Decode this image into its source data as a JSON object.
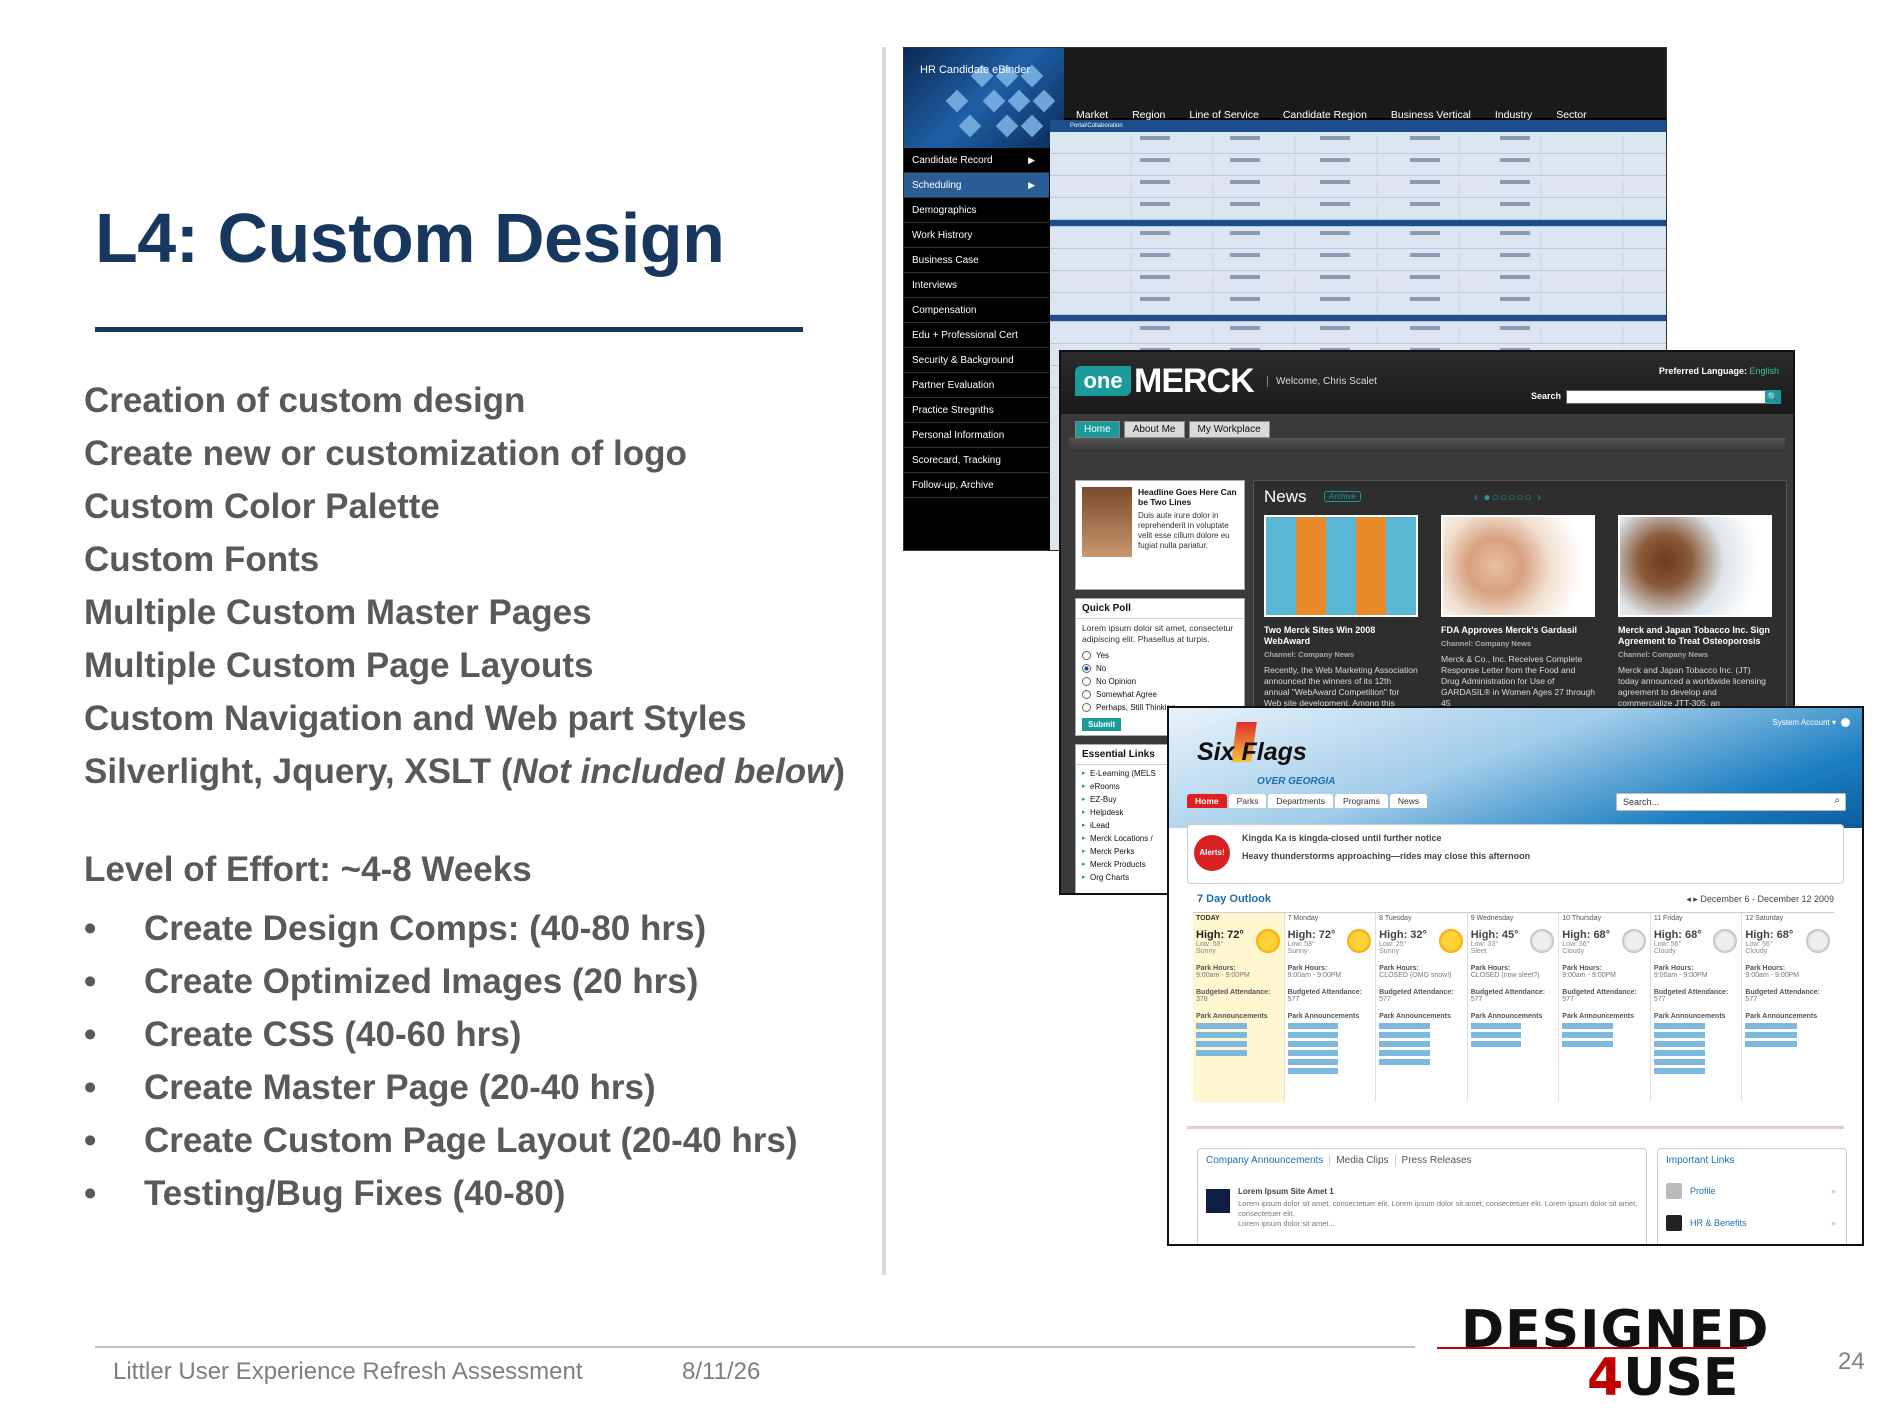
{
  "slide": {
    "title": "L4: Custom Design",
    "features": [
      "Creation of custom design",
      "Create new or customization of logo",
      "Custom Color Palette",
      "Custom Fonts",
      "Multiple Custom Master Pages",
      "Multiple Custom Page Layouts",
      "Custom Navigation and Web part Styles"
    ],
    "tech_line_prefix": "Silverlight, Jquery, XSLT (",
    "tech_line_italic": "Not included below",
    "tech_line_suffix": ")",
    "effort_label": "Level of Effort: ~4-8 Weeks",
    "bullet": "•",
    "tasks": [
      "Create Design Comps: (40-80 hrs)",
      "Create Optimized Images (20 hrs)",
      "Create CSS (40-60 hrs)",
      "Create Master Page (20-40 hrs)",
      "Create Custom Page Layout (20-40 hrs)",
      "Testing/Bug Fixes (40-80)"
    ]
  },
  "footer": {
    "text": "Littler User Experience Refresh Assessment",
    "date": "8/11/26",
    "page": "24",
    "logo_line1": "DESIGNED",
    "logo_four": "4",
    "logo_use": "USE"
  },
  "hr_ebinder": {
    "title": "HR Candidate eBinder",
    "columns": [
      "Market",
      "Region",
      "Line of Service",
      "Candidate Region",
      "Business Vertical",
      "Industry",
      "Sector"
    ],
    "grid_header": "Portal/Collaboration",
    "side_items": [
      "Candidate Record",
      "Scheduling",
      "Demographics",
      "Work Histrory",
      "Business Case",
      "Interviews",
      "Compensation",
      "Edu + Professional Cert",
      "Security & Background",
      "Partner Evaluation",
      "Practice Stregnths",
      "Personal Information",
      "Scorecard, Tracking",
      "Follow-up, Archive"
    ],
    "arrow": "▶"
  },
  "onemerck": {
    "logo_one": "one",
    "logo_merck": "MERCK",
    "welcome": "Welcome, Chris Scalet",
    "pref_label": "Preferred Language:",
    "pref_value": "English",
    "search_label": "Search",
    "search_icon": "🔍",
    "nav": [
      "Home",
      "About Me",
      "My Workplace"
    ],
    "feature_title": "Headline Goes Here Can be Two Lines",
    "feature_body": "Duis aute irure dolor in reprehenderit in voluptate velit esse cillum dolore eu fugiat nulla pariatur.",
    "poll_title": "Quick Poll",
    "poll_question": "Lorem ipsum dolor sit amet, consectetur adipiscing elit. Phasellus at turpis.",
    "poll_options": [
      "Yes",
      "No",
      "No Opinion",
      "Somewhat Agree",
      "Perhaps, Still Thinking"
    ],
    "poll_submit": "Submit",
    "links_title": "Essential Links",
    "links": [
      "E-Learning (MELS",
      "eRooms",
      "EZ-Buy",
      "Helpdesk",
      "iLead",
      "Merck Locations /",
      "Merck Perks",
      "Merck Products",
      "Org Charts"
    ],
    "news_title": "News",
    "news_archive": "Archive",
    "news_pager": "‹ ●○○○○○ ›",
    "news": [
      {
        "headline": "Two Merck Sites Win 2008 WebAward",
        "channel": "Channel: Company News",
        "body": "Recently, the Web Marketing Association announced the winners of its 12th annual \"WebAward Competition\" for Web site development. Among this year's"
      },
      {
        "headline": "FDA Approves Merck's Gardasil",
        "channel": "Channel: Company News",
        "body": "Merck & Co., Inc. Receives Complete Response Letter from the Food and Drug Administration for Use of GARDASIL® in Women Ages 27 through 45"
      },
      {
        "headline": "Merck and Japan Tobacco Inc. Sign Agreement to Treat Osteoporosis",
        "channel": "Channel: Company News",
        "body": "Merck and Japan Tobacco Inc. (JT) today announced a worldwide licensing agreement to develop and commercialize JTT-305, an"
      }
    ]
  },
  "sixflags": {
    "logo_six": "Six",
    "logo_flags": "Flags",
    "logo_sub": "OVER GEORGIA",
    "account": "System Account ▾",
    "tabs": [
      "Home",
      "Parks",
      "Departments",
      "Programs",
      "News"
    ],
    "search_placeholder": "Search...",
    "search_icon": "⌕",
    "alert_badge": "Alerts!",
    "alerts": [
      "Kingda Ka is kingda-closed until further notice",
      "Heavy thunderstorms approaching—rides may close this afternoon"
    ],
    "outlook_title": "7 Day Outlook",
    "outlook_range": "◂ ▸  December 6 - December 12 2009",
    "days": [
      {
        "name": "TODAY",
        "high": "High: 72°",
        "low": "Low: 58°",
        "cond": "Sunny",
        "hours": "9:00am - 9:00PM",
        "attendance": "378",
        "icon": "sun"
      },
      {
        "name": "7  Monday",
        "high": "High: 72°",
        "low": "Low: 58°",
        "cond": "Sunny",
        "hours": "9:00am - 9:00PM",
        "attendance": "577",
        "icon": "sun"
      },
      {
        "name": "8  Tuesday",
        "high": "High: 32°",
        "low": "Low: 25°",
        "cond": "Sunny",
        "hours": "CLOSED (OMG snow!)",
        "attendance": "577",
        "icon": "sun"
      },
      {
        "name": "9  Wednesday",
        "high": "High: 45°",
        "low": "Low: 33°",
        "cond": "Sleet",
        "hours": "CLOSED (now sleet?)",
        "attendance": "577",
        "icon": "cloud"
      },
      {
        "name": "10  Thursday",
        "high": "High: 68°",
        "low": "Low: 56°",
        "cond": "Cloudy",
        "hours": "9:00am - 9:00PM",
        "attendance": "577",
        "icon": "cloud"
      },
      {
        "name": "11  Friday",
        "high": "High: 68°",
        "low": "Low: 56°",
        "cond": "Cloudy",
        "hours": "9:00am - 9:00PM",
        "attendance": "577",
        "icon": "cloud"
      },
      {
        "name": "12  Saturday",
        "high": "High: 68°",
        "low": "Low: 56°",
        "cond": "Cloudy",
        "hours": "9:00am - 9:00PM",
        "attendance": "577",
        "icon": "cloud"
      }
    ],
    "park_hours_label": "Park Hours:",
    "attendance_label": "Budgeted Attendance:",
    "announcements_label": "Park Announcements",
    "comp_tabs": [
      "Company Announcements",
      "Media Clips",
      "Press Releases"
    ],
    "comp_item_title": "Lorem Ipsum Site Amet 1",
    "comp_item_body": "Lorem ipsum dolor sit amet, consectetuer elit. Lorem ipsum dolor sit amet, consectetuer elit. Lorem ipsum dolor sit amet, consectetuer elit.",
    "comp_item_body2": "Lorem ipsum dolor sit amet...",
    "important_title": "Important Links",
    "important_links": [
      "Profile",
      "HR & Benefits"
    ],
    "chevron": "»"
  }
}
